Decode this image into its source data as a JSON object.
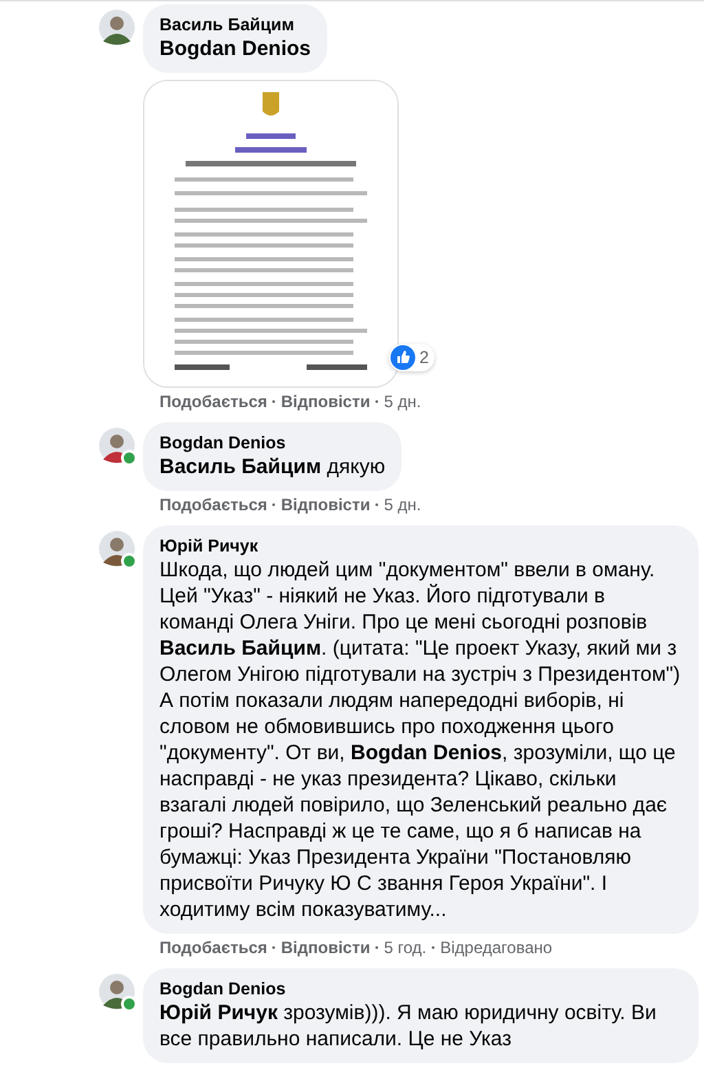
{
  "comments": [
    {
      "author": "Василь Байцим",
      "online": false,
      "mention": "Bogdan Denios",
      "attachment": {
        "kind": "picture"
      },
      "reactions": {
        "count": "2"
      },
      "meta": [
        {
          "kind": "action",
          "text": "Подобається"
        },
        {
          "kind": "action",
          "text": "Відповісти"
        },
        {
          "kind": "time",
          "text": "5 дн."
        }
      ]
    },
    {
      "author": "Bogdan Denios",
      "online": true,
      "mention": "Василь Байцим",
      "text": "дякую",
      "meta": [
        {
          "kind": "action",
          "text": "Подобається"
        },
        {
          "kind": "action",
          "text": "Відповісти"
        },
        {
          "kind": "time",
          "text": "5 дн."
        }
      ]
    },
    {
      "author": "Юрій Ричук",
      "online": true,
      "text": "Шкода, що людей цим \"документом\" ввели в оману. Цей \"Указ\" - ніякий не Указ. Його підготували в команді Олега Уніги. Про це мені сьогодні розповів **Василь Байцим**. (цитата: \"Це проект Указу, який ми з Олегом Унігою підготували на зустріч з Президентом\") А потім показали людям напередодні виборів, ні словом не обмовившись про походження цього \"документу\". От ви, **Bogdan Denios**, зрозуміли, що це насправді - не указ президента? Цікаво, скільки взагалі людей повірило, що Зеленський реально дає гроші? Насправді ж це те саме, що я б написав на бумажці: Указ Президента України \"Постановляю присвоїти Ричуку Ю С звання Героя України\". І ходитиму всім показуватиму...",
      "meta": [
        {
          "kind": "action",
          "text": "Подобається"
        },
        {
          "kind": "action",
          "text": "Відповісти"
        },
        {
          "kind": "time",
          "text": "5 год."
        },
        {
          "kind": "edited",
          "text": "Відредаговано"
        }
      ]
    },
    {
      "author": "Bogdan Denios",
      "online": true,
      "mention": "Юрій Ричук",
      "text": "зрозумів))). Я маю юридичну освіту. Ви все правильно написали. Це не Указ"
    }
  ]
}
